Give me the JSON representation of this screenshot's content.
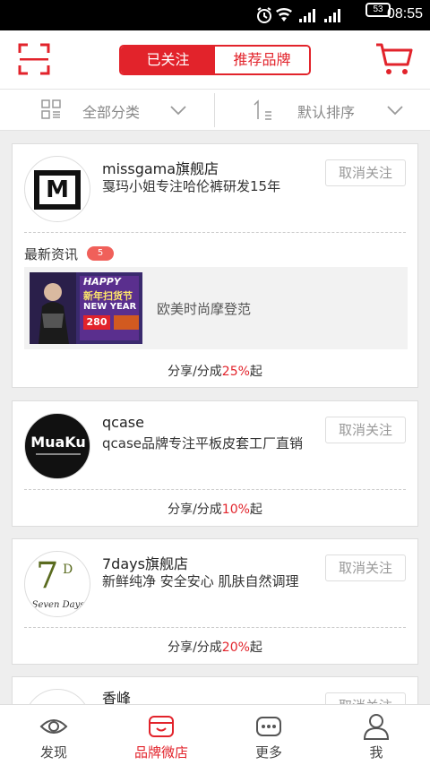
{
  "status_bar": {
    "time": "08:55",
    "battery": "53"
  },
  "header": {
    "tab_following": "已关注",
    "tab_recommended": "推荐品牌"
  },
  "filter": {
    "category_label": "全部分类",
    "sort_label": "默认排序"
  },
  "brands": [
    {
      "name": "missgama旗舰店",
      "description": "戛玛小姐专注哈伦裤研发15年",
      "unfollow_label": "取消关注",
      "logo_text": "M",
      "news_title": "最新资讯",
      "news_count": "5",
      "news_banner": {
        "line1": "HAPPY",
        "line2": "新年扫货节",
        "line3": "NEW YEAR",
        "line4": "280"
      },
      "news_text": "欧美时尚摩登范",
      "share_prefix": "分享/分成",
      "share_percent": "25%",
      "share_suffix": "起"
    },
    {
      "name": "qcase",
      "description": "qcase品牌专注平板皮套工厂直销",
      "unfollow_label": "取消关注",
      "logo_text": "MuaKu",
      "share_prefix": "分享/分成",
      "share_percent": "10%",
      "share_suffix": "起"
    },
    {
      "name": "7days旗舰店",
      "description": "新鲜纯净 安全安心 肌肤自然调理",
      "unfollow_label": "取消关注",
      "logo_text": "7",
      "logo_sup": "D",
      "logo_sub": "Seven Days",
      "share_prefix": "分享/分成",
      "share_percent": "20%",
      "share_suffix": "起"
    },
    {
      "name": "香峰",
      "unfollow_label": "取消关注"
    }
  ],
  "tabbar": [
    {
      "label": "发现",
      "icon": "eye-icon"
    },
    {
      "label": "品牌微店",
      "icon": "shop-icon"
    },
    {
      "label": "更多",
      "icon": "more-dots-icon"
    },
    {
      "label": "我",
      "icon": "person-icon"
    }
  ],
  "colors": {
    "accent": "#e2232b",
    "background": "#eeeeee"
  }
}
